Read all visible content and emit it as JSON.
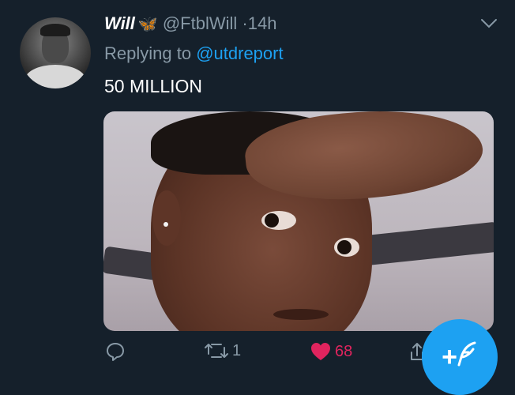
{
  "tweet": {
    "display_name": "Will",
    "name_emoji": "🦋",
    "handle": "@FtblWill",
    "separator": "·",
    "time": "14h",
    "reply_prefix": "Replying to",
    "reply_to": "@utdreport",
    "text": "50 MILLION"
  },
  "actions": {
    "reply_count": "",
    "retweet_count": "1",
    "like_count": "68",
    "like_color": "#e0245e"
  },
  "fab": {
    "label": "+"
  },
  "colors": {
    "background": "#15202b",
    "muted": "#8899a6",
    "accent": "#1da1f2"
  },
  "icons": {
    "reply": "reply-icon",
    "retweet": "retweet-icon",
    "like": "heart-icon",
    "share": "share-icon",
    "more": "chevron-down-icon",
    "compose": "compose-feather-icon"
  }
}
